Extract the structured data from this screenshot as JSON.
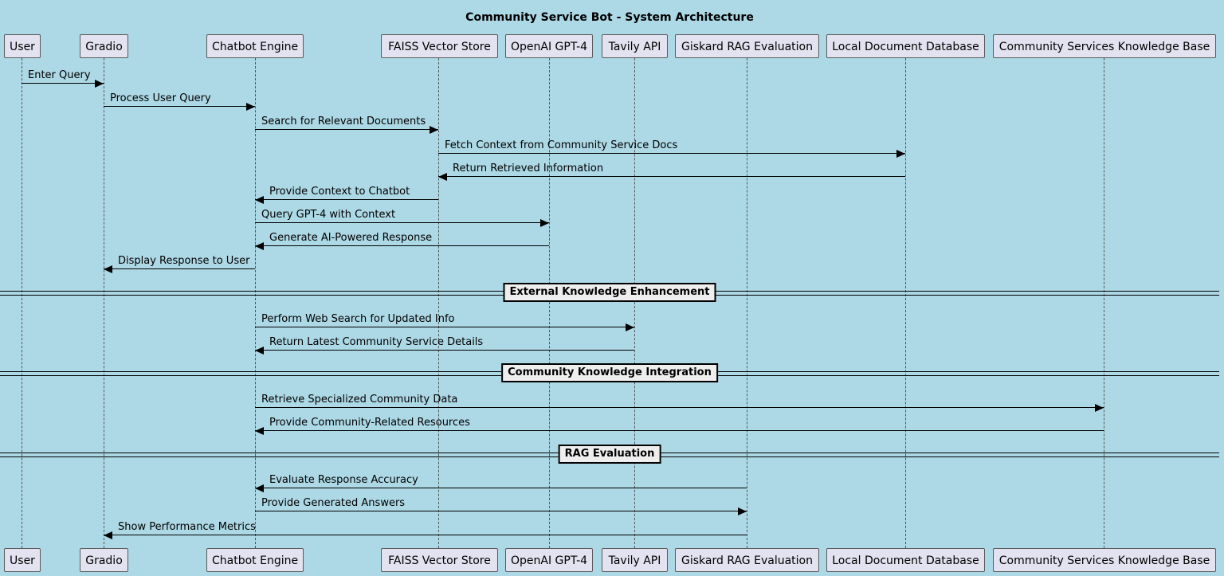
{
  "title": "Community Service Bot - System Architecture",
  "participants": [
    {
      "name": "User"
    },
    {
      "name": "Gradio"
    },
    {
      "name": "Chatbot Engine"
    },
    {
      "name": "FAISS Vector Store"
    },
    {
      "name": "OpenAI GPT-4"
    },
    {
      "name": "Tavily API"
    },
    {
      "name": "Giskard RAG Evaluation"
    },
    {
      "name": "Local Document Database"
    },
    {
      "name": "Community Services Knowledge Base"
    }
  ],
  "messages": [
    {
      "from": 0,
      "to": 1,
      "label": "Enter Query"
    },
    {
      "from": 1,
      "to": 2,
      "label": "Process User Query"
    },
    {
      "from": 2,
      "to": 3,
      "label": "Search for Relevant Documents"
    },
    {
      "from": 3,
      "to": 7,
      "label": "Fetch Context from Community Service Docs"
    },
    {
      "from": 7,
      "to": 3,
      "label": "Return Retrieved Information"
    },
    {
      "from": 3,
      "to": 2,
      "label": "Provide Context to Chatbot"
    },
    {
      "from": 2,
      "to": 4,
      "label": "Query GPT-4 with Context"
    },
    {
      "from": 4,
      "to": 2,
      "label": "Generate AI-Powered Response"
    },
    {
      "from": 2,
      "to": 1,
      "label": "Display Response to User"
    },
    {
      "divider": "External Knowledge Enhancement"
    },
    {
      "from": 2,
      "to": 5,
      "label": "Perform Web Search for Updated Info"
    },
    {
      "from": 5,
      "to": 2,
      "label": "Return Latest Community Service Details"
    },
    {
      "divider": "Community Knowledge Integration"
    },
    {
      "from": 2,
      "to": 8,
      "label": "Retrieve Specialized Community Data"
    },
    {
      "from": 8,
      "to": 2,
      "label": "Provide Community-Related Resources"
    },
    {
      "divider": "RAG Evaluation"
    },
    {
      "from": 6,
      "to": 2,
      "label": "Evaluate Response Accuracy"
    },
    {
      "from": 2,
      "to": 6,
      "label": "Provide Generated Answers"
    },
    {
      "from": 6,
      "to": 1,
      "label": "Show Performance Metrics"
    }
  ]
}
